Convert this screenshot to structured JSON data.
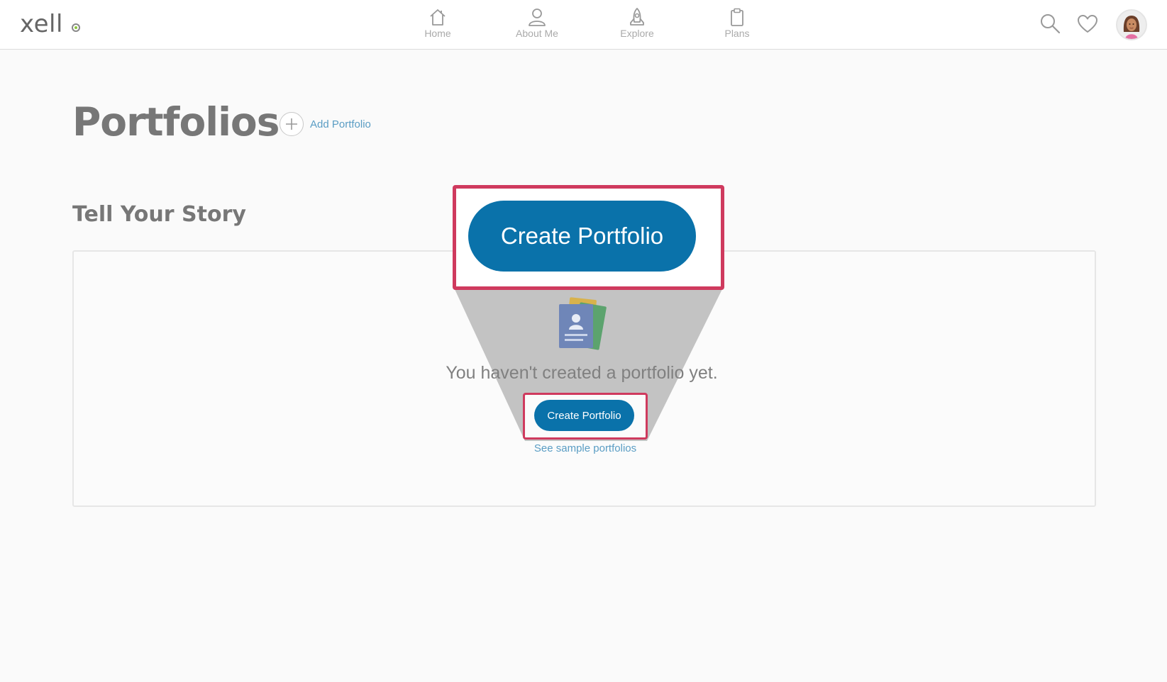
{
  "header": {
    "logo": "xell",
    "nav": [
      {
        "label": "Home",
        "icon": "home-icon"
      },
      {
        "label": "About Me",
        "icon": "person-icon"
      },
      {
        "label": "Explore",
        "icon": "rocket-icon"
      },
      {
        "label": "Plans",
        "icon": "clipboard-icon"
      }
    ],
    "actions": [
      "search-icon",
      "heart-icon",
      "avatar"
    ]
  },
  "page": {
    "title": "Portfolios",
    "add_label": "Add Portfolio",
    "section_title": "Tell Your Story"
  },
  "empty_state": {
    "message": "You haven't created a portfolio yet.",
    "button_label": "Create Portfolio",
    "sample_link": "See sample portfolios"
  },
  "callout": {
    "button_label": "Create Portfolio",
    "highlight_color": "#cf3a5e"
  },
  "colors": {
    "primary": "#0a72aa",
    "link": "#5a9dc4",
    "logo_accent": "#8cc63f"
  }
}
